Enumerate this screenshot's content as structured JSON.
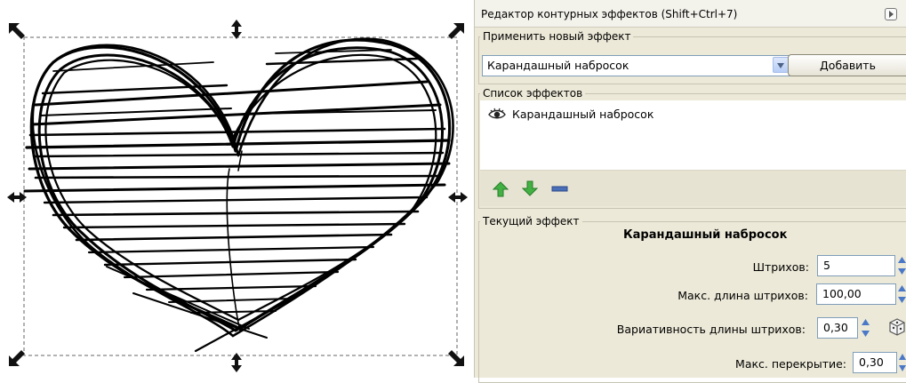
{
  "panel": {
    "title": "Редактор контурных эффектов (Shift+Ctrl+7)",
    "apply_section": {
      "legend": "Применить новый эффект",
      "selected_effect": "Карандашный набросок",
      "add_button": "Добавить"
    },
    "effects_list": {
      "legend": "Список эффектов",
      "items": [
        {
          "label": "Карандашный набросок",
          "icon": "eye-icon"
        }
      ],
      "toolbar_icons": [
        "arrow-up-icon",
        "arrow-down-icon",
        "remove-icon"
      ]
    },
    "current_effect": {
      "legend": "Текущий эффект",
      "name": "Карандашный набросок",
      "params": {
        "strokes": {
          "label": "Штрихов:",
          "value": "5"
        },
        "max_length": {
          "label": "Макс. длина штрихов:",
          "value": "100,00"
        },
        "length_variation": {
          "label": "Вариативность длины штрихов:",
          "value": "0,30"
        },
        "max_overlap": {
          "label": "Макс. перекрытие:",
          "value": "0,30"
        }
      }
    }
  },
  "colors": {
    "panel_bg": "#ece9d8",
    "arrow_green": "#3fa83f",
    "remove_blue": "#3a5fa8",
    "stroke": "#000000"
  }
}
